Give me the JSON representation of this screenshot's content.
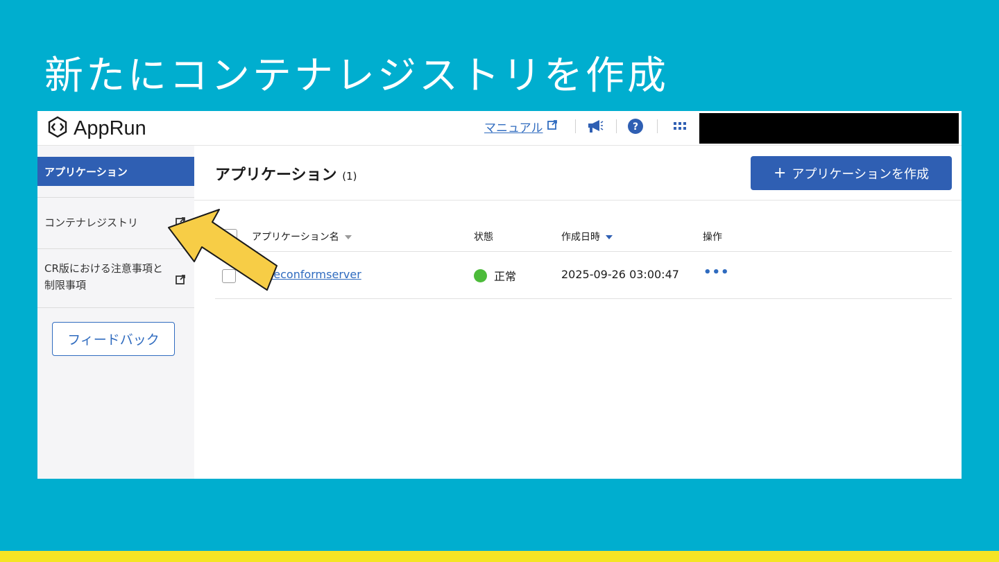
{
  "slide": {
    "title": "新たにコンテナレジストリを作成"
  },
  "header": {
    "app_name": "AppRun",
    "manual_label": "マニュアル",
    "icons": [
      "external-link-icon",
      "megaphone-icon",
      "help-icon",
      "apps-grid-icon"
    ]
  },
  "sidebar": {
    "items": [
      {
        "label": "アプリケーション",
        "active": true
      },
      {
        "label": "コンテナレジストリ",
        "external": true
      },
      {
        "label": "CR版における注意事項と制限事項",
        "external": true
      }
    ],
    "feedback_label": "フィードバック"
  },
  "main": {
    "title": "アプリケーション",
    "count": "(1)",
    "create_button": "アプリケーションを作成",
    "columns": [
      "アプリケーション名",
      "状態",
      "作成日時",
      "操作"
    ],
    "rows": [
      {
        "name": "...econformserver",
        "status": "正常",
        "created": "2025-09-26 03:00:47"
      }
    ]
  },
  "colors": {
    "background": "#00aecf",
    "primary": "#2f5fb3",
    "link": "#2f6bbf",
    "status_ok": "#4cbb3a",
    "arrow": "#f7cd46",
    "bottom_bar": "#f5e424"
  }
}
